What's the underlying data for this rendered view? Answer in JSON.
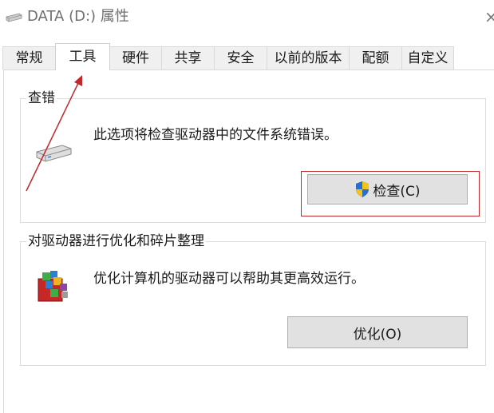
{
  "window": {
    "title": "DATA (D:) 属性",
    "close_glyph": "×"
  },
  "tabs": [
    {
      "label": "常规",
      "active": false
    },
    {
      "label": "工具",
      "active": true
    },
    {
      "label": "硬件",
      "active": false
    },
    {
      "label": "共享",
      "active": false
    },
    {
      "label": "安全",
      "active": false
    },
    {
      "label": "以前的版本",
      "active": false
    },
    {
      "label": "配额",
      "active": false
    },
    {
      "label": "自定义",
      "active": false
    }
  ],
  "error_check": {
    "group_label": "查错",
    "description": "此选项将检查驱动器中的文件系统错误。",
    "button_label": "检查(C)",
    "icon": "drive-icon",
    "button_icon": "uac-shield-icon"
  },
  "optimize": {
    "group_label": "对驱动器进行优化和碎片整理",
    "description": "优化计算机的驱动器可以帮助其更高效运行。",
    "button_label": "优化(O)",
    "icon": "defrag-icon"
  },
  "colors": {
    "annotation_red": "#c0292c",
    "button_face": "#e1e1e1",
    "tab_inactive": "#f0f0f0"
  }
}
